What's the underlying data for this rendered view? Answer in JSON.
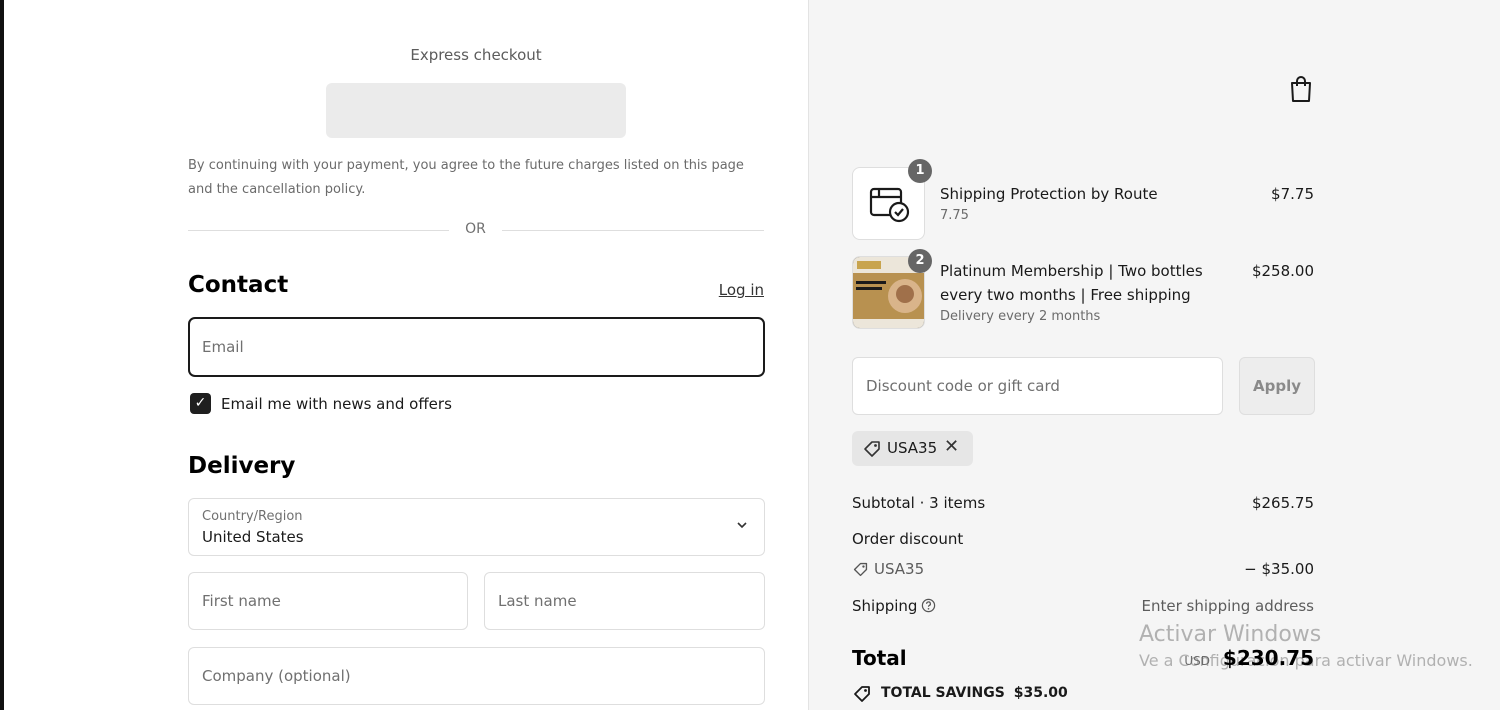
{
  "express": {
    "title": "Express checkout",
    "consent": "By continuing with your payment, you agree to the future charges listed on this page and the cancellation policy.",
    "or_text": "OR"
  },
  "contact": {
    "heading": "Contact",
    "login_label": "Log in",
    "email_placeholder": "Email",
    "newsletter_label": "Email me with news and offers",
    "newsletter_checked": true
  },
  "delivery": {
    "heading": "Delivery",
    "country_label": "Country/Region",
    "country_value": "United States",
    "first_name_placeholder": "First name",
    "last_name_placeholder": "Last name",
    "company_placeholder": "Company (optional)"
  },
  "summary": {
    "items": [
      {
        "quantity": "1",
        "name": "Shipping Protection by Route",
        "sub": "7.75",
        "price": "$7.75",
        "icon": "package-check-icon"
      },
      {
        "quantity": "2",
        "name": "Platinum Membership | Two bottles every two months | Free shipping",
        "sub": "Delivery every 2 months",
        "price": "$258.00",
        "icon": "membership-product-image"
      }
    ],
    "discount_placeholder": "Discount code or gift card",
    "apply_label": "Apply",
    "applied_code": "USA35",
    "subtotal_label": "Subtotal · 3 items",
    "subtotal_value": "$265.75",
    "order_discount_label": "Order discount",
    "discount_code": "USA35",
    "discount_value": "− $35.00",
    "shipping_label": "Shipping",
    "shipping_value": "Enter shipping address",
    "total_label": "Total",
    "currency": "USD",
    "total_value": "$230.75",
    "savings_label": "TOTAL SAVINGS",
    "savings_value": "$35.00"
  },
  "watermark": {
    "line1": "Activar Windows",
    "line2": "Ve a Configuración para activar Windows."
  },
  "colors": {
    "accent_dark": "#1a1a1a",
    "summary_bg": "#f5f5f5",
    "badge": "#666666"
  }
}
